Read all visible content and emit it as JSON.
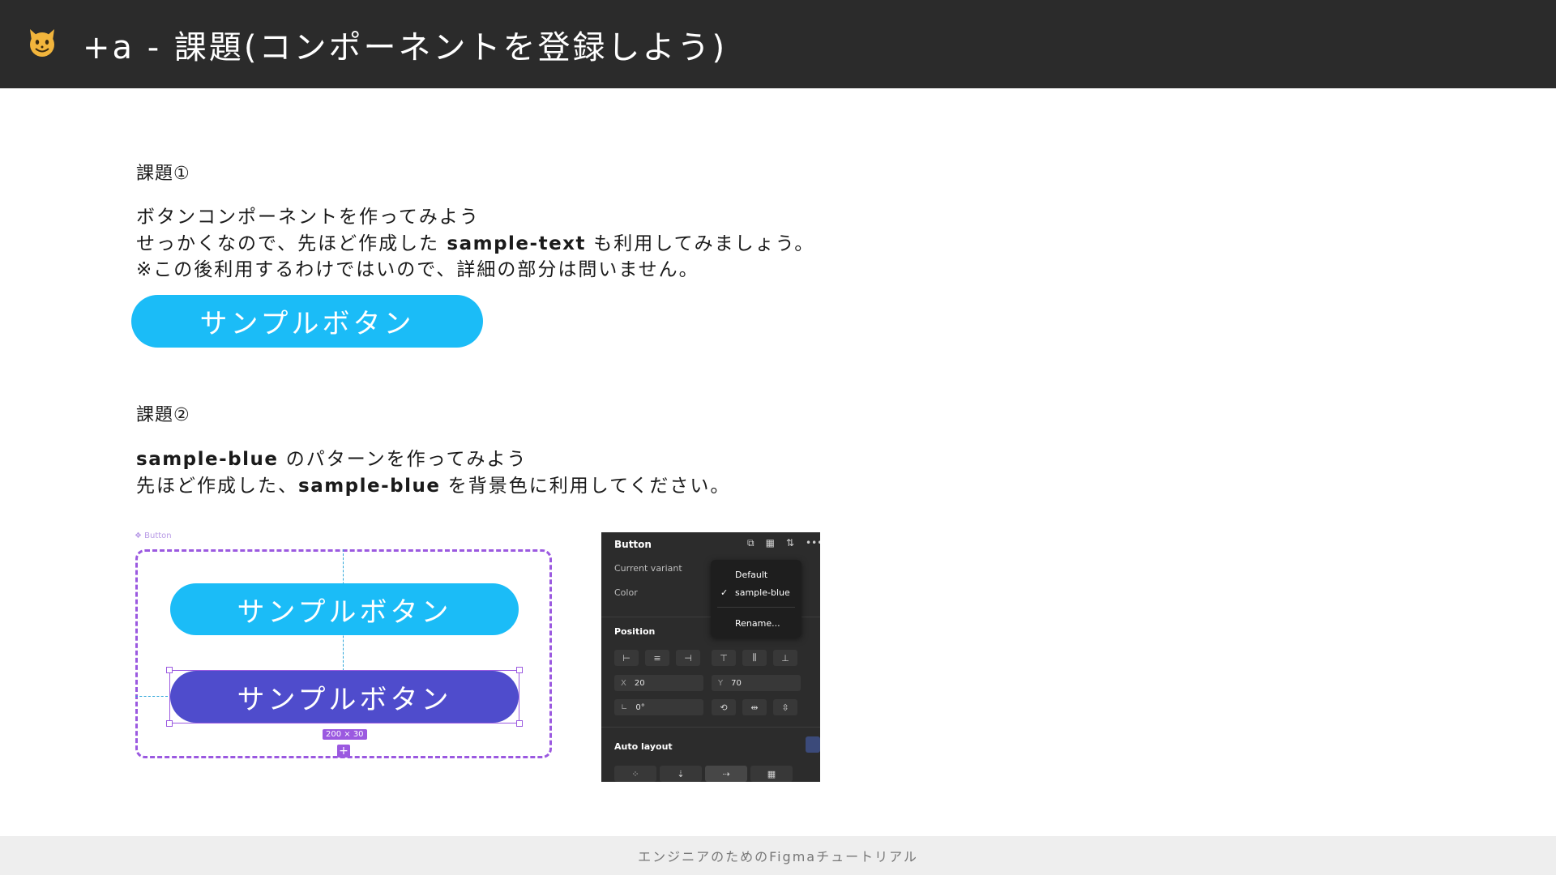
{
  "header": {
    "title": "+a - 課題(コンポーネントを登録しよう)"
  },
  "task1": {
    "label": "課題①",
    "lines": [
      "ボタンコンポーネントを作ってみよう"
    ],
    "line2_pre": "せっかくなので、先ほど作成した ",
    "line2_bold": "sample-text",
    "line2_post": " も利用してみましょう。",
    "line3": "※この後利用するわけではいので、詳細の部分は問いません。",
    "sample_button": "サンプルボタン"
  },
  "task2": {
    "label": "課題②",
    "line1_bold": "sample-blue",
    "line1_post": " のパターンを作ってみよう",
    "line2_pre": "先ほど作成した、",
    "line2_bold": "sample-blue",
    "line2_post": " を背景色に利用してください。"
  },
  "canvas": {
    "component_label": "❖ Button",
    "button_top": "サンプルボタン",
    "button_bottom": "サンプルボタン",
    "size_badge": "200 × 30",
    "plus": "+"
  },
  "panel": {
    "title": "Button",
    "current_variant": "Current variant",
    "color": "Color",
    "position": "Position",
    "x_key": "X",
    "x_value": "20",
    "y_key": "Y",
    "y_value": "70",
    "angle_key": "∟",
    "angle_value": "0°",
    "auto_layout": "Auto layout",
    "dropdown": {
      "default": "Default",
      "selected": "sample-blue",
      "rename": "Rename..."
    }
  },
  "footer": {
    "text": "エンジニアのためのFigmaチュートリアル"
  },
  "colors": {
    "header_bg": "#2b2b2b",
    "sample_blue": "#1bbcf7",
    "variant_purple": "#4f4ccc",
    "selection": "#9b59e0"
  }
}
